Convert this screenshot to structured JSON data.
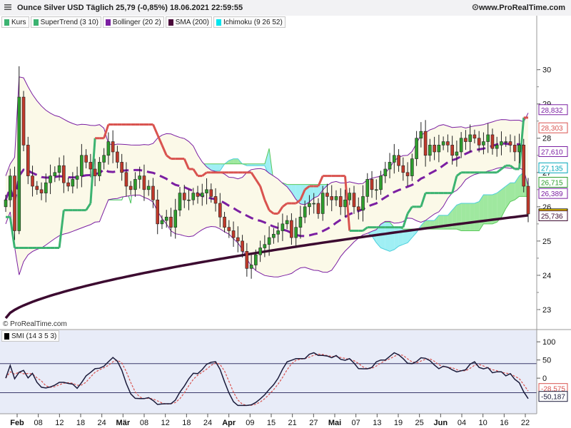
{
  "header": {
    "title": "Ounce Silver USD Täglich 25,79 (-0,85%) 18.06.2021 22:59:55",
    "brand": "www.ProRealTime.com"
  },
  "watermark": "© ProRealTime.com",
  "legend": [
    {
      "label": "Kurs",
      "color": "#3cb371"
    },
    {
      "label": "SuperTrend (3 10)",
      "color": "#3cb371"
    },
    {
      "label": "Bollinger (20 2)",
      "color": "#7b1fa2"
    },
    {
      "label": "SMA (200)",
      "color": "#4a0a3a"
    },
    {
      "label": "Ichimoku (9 26 52)",
      "color": "#00e5ee"
    }
  ],
  "indicator_legend": {
    "label": "SMI (14 3 5 3)",
    "color": "#000000"
  },
  "colors": {
    "up": "#2e9e2e",
    "down": "#c0392b",
    "supertrend_bull": "#3cb371",
    "supertrend_bear": "#d9534f",
    "bollinger": "#7b1fa2",
    "bollinger_mid": "#7b1fa2",
    "sma": "#3c0a30",
    "kumo_bull": "#7fe07f",
    "kumo_bear": "#7fe9f0",
    "smi": "#1a1a3a",
    "smi_signal": "#d9534f",
    "indicator_bg": "#e8ecf8"
  },
  "chart_data": [
    {
      "type": "line",
      "title": "Ounce Silver USD Täglich",
      "ylim": [
        22.5,
        31.2
      ],
      "yticks": [
        "23",
        "24",
        "25",
        "26",
        "27",
        "28",
        "29",
        "30"
      ],
      "x_dates": [
        "Feb",
        "08",
        "12",
        "18",
        "24",
        "Mär",
        "08",
        "12",
        "18",
        "24",
        "Apr",
        "09",
        "15",
        "21",
        "27",
        "Mai",
        "07",
        "13",
        "19",
        "25",
        "Jun",
        "04",
        "10",
        "16",
        "22"
      ],
      "bold_dates": [
        "Feb",
        "Mär",
        "Apr",
        "Mai",
        "Jun"
      ],
      "price_tags": [
        {
          "label": "28,832",
          "value": 28.832,
          "color": "#7b1fa2",
          "bg": "#ffffff"
        },
        {
          "label": "28,303",
          "value": 28.303,
          "color": "#d9534f",
          "bg": "#ffffff"
        },
        {
          "label": "27,610",
          "value": 27.61,
          "color": "#7b1fa2",
          "bg": "#ffffff"
        },
        {
          "label": "27,135",
          "value": 27.135,
          "color": "#00a6b8",
          "bg": "#ffffff"
        },
        {
          "label": "26,715",
          "value": 26.715,
          "color": "#2e9e2e",
          "bg": "#ffffff"
        },
        {
          "label": "26,389",
          "value": 26.389,
          "color": "#7b1fa2",
          "bg": "#ffffff"
        },
        {
          "label": "25,79",
          "value": 25.79,
          "color": "#000000",
          "bg": "#ffd700"
        },
        {
          "label": "25,736",
          "value": 25.736,
          "color": "#3c0a30",
          "bg": "#ffffff"
        }
      ],
      "candles_close": [
        26.2,
        26.9,
        25.3,
        29.2,
        27.8,
        26.9,
        26.6,
        26.5,
        26.4,
        26.7,
        26.9,
        27.0,
        27.2,
        26.7,
        26.6,
        26.8,
        26.9,
        27.5,
        27.3,
        27.1,
        26.9,
        27.3,
        27.5,
        27.9,
        27.6,
        27.3,
        27.0,
        26.6,
        26.5,
        26.8,
        26.9,
        26.5,
        26.6,
        26.2,
        25.5,
        25.6,
        25.7,
        25.4,
        25.9,
        26.4,
        26.2,
        26.2,
        26.4,
        26.3,
        26.4,
        26.5,
        26.3,
        26.1,
        25.7,
        25.4,
        25.3,
        25.1,
        25.0,
        24.7,
        24.2,
        24.3,
        24.6,
        24.8,
        24.9,
        25.1,
        25.2,
        25.3,
        25.5,
        25.6,
        25.1,
        25.4,
        25.7,
        26.0,
        26.1,
        26.1,
        25.8,
        26.4,
        26.3,
        26.2,
        26.3,
        26.0,
        26.2,
        26.4,
        26.0,
        25.9,
        26.3,
        26.8,
        26.5,
        26.5,
        26.9,
        27.1,
        27.3,
        27.5,
        27.2,
        27.0,
        26.9,
        27.4,
        28.0,
        28.2,
        27.5,
        27.8,
        27.6,
        27.8,
        27.9,
        27.8,
        27.5,
        27.6,
        28.0,
        27.9,
        28.1,
        28.0,
        27.8,
        27.9,
        28.1,
        27.7,
        27.8,
        27.9,
        27.9,
        27.8,
        27.6,
        27.8,
        26.6,
        25.79
      ]
    },
    {
      "type": "line",
      "title": "SMI (14 3 5 3)",
      "ylim": [
        -90,
        118
      ],
      "yticks": [
        "100",
        "50",
        "0"
      ],
      "levels": [
        40,
        -40
      ],
      "price_tags": [
        {
          "label": "-28,575",
          "value": -28.575,
          "color": "#d9534f",
          "bg": "#ffffff"
        },
        {
          "label": "-50,187",
          "value": -50.187,
          "color": "#1a1a3a",
          "bg": "#ffffff"
        }
      ]
    }
  ]
}
